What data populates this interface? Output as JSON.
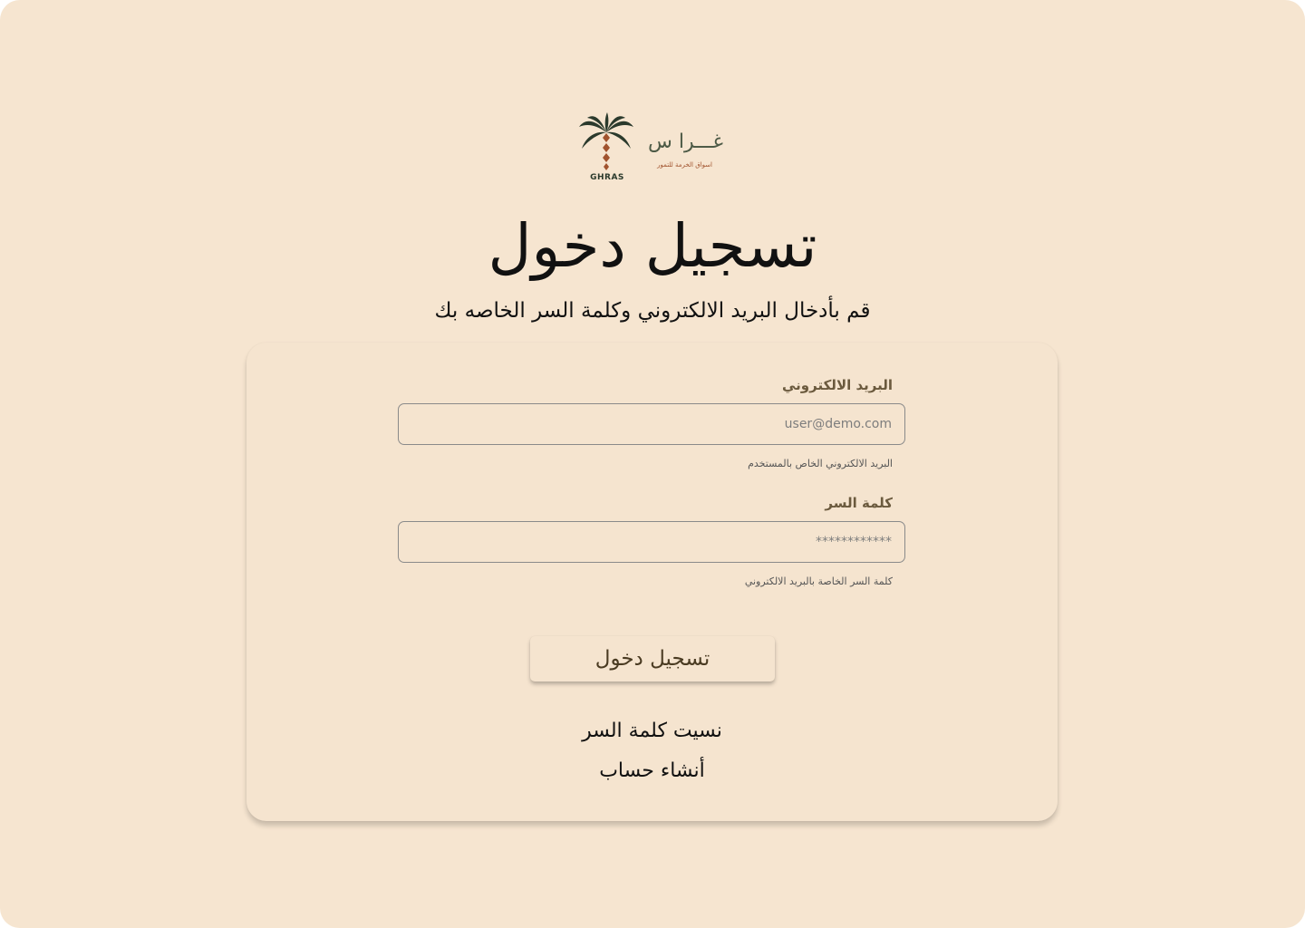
{
  "logo": {
    "name_ar": "غـــرا س",
    "tagline": "اسواق الخرمة للتمور",
    "name_en": "GHRAS",
    "colors": {
      "leaves": "#2b3a2c",
      "trunk": "#a0522d"
    }
  },
  "header": {
    "title": "تسجيل دخول",
    "subtitle": "قم بأدخال البريد الالكتروني وكلمة السر الخاصه بك"
  },
  "form": {
    "email": {
      "label": "البريد الالكتروني",
      "placeholder": "user@demo.com",
      "value": "",
      "hint": "البريد الالكتروني الخاص بالمستخدم"
    },
    "password": {
      "label": "كلمة السر",
      "placeholder": "************",
      "value": "",
      "hint": "كلمة السر الخاصة بالبريد الالكتروني"
    },
    "submit_label": "تسجيل دخول"
  },
  "links": {
    "forgot_password": "نسيت كلمة السر",
    "create_account": "أنشاء حساب"
  },
  "theme": {
    "background": "#f6e5d0",
    "card": "#f5e4cf",
    "label_color": "#6b5a3e",
    "button_text": "#4a3b22"
  }
}
